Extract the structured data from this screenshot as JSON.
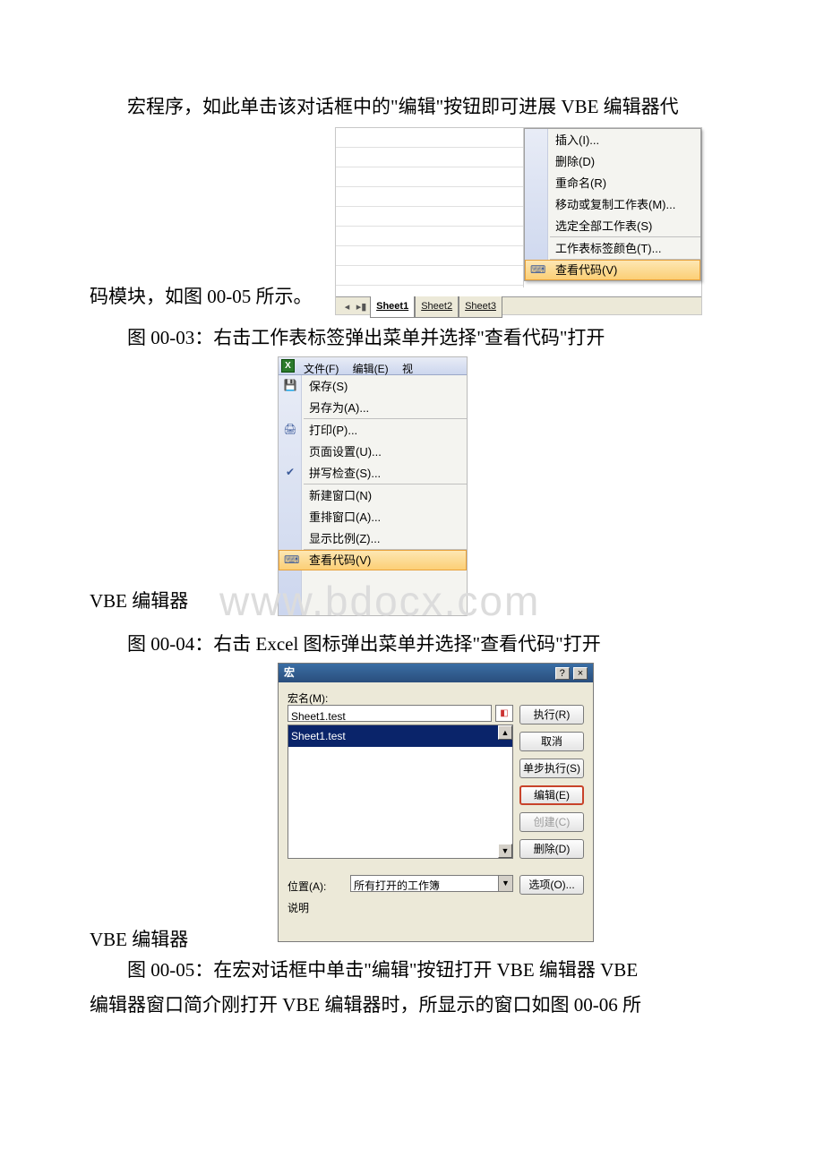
{
  "para1_a": "宏程序，如此单击该对话框中的\"编辑\"按钮即可进展 ",
  "para1_b": "VBE",
  "para1_c": " 编辑器代",
  "para2_a": "码模块，如图 00-05 所示。",
  "cap3": "图 00-03：右击工作表标签弹出菜单并选择\"查看代码\"打开",
  "cap4_a": "VBE",
  "cap4_b": " 编辑器",
  "cap4_full": "图 00-04：右击 Excel 图标弹出菜单并选择\"查看代码\"打开",
  "cap5_a": "VBE",
  "cap5_b": " 编辑器",
  "cap5_full_a": "图 00-05：在宏对话框中单击\"编辑\"按钮打开 ",
  "cap5_full_b": "VBE",
  "cap5_full_c": " 编辑器 ",
  "cap5_full_d": "VBE",
  "cap5_full_e": "编辑器窗口简介刚打开 ",
  "cap5_full_f": "VBE",
  "cap5_full_g": " 编辑器时，所显示的窗口如图 00-06 所",
  "watermark": "www.bdocx.com",
  "fig3": {
    "menu": {
      "insert": "插入(I)...",
      "delete": "删除(D)",
      "rename": "重命名(R)",
      "movecopy": "移动或复制工作表(M)...",
      "selectall": "选定全部工作表(S)",
      "tabcolor": "工作表标签颜色(T)...",
      "viewcode": "查看代码(V)"
    },
    "tabs": {
      "nav": "▸ ▸|",
      "s1": "Sheet1",
      "s2": "Sheet2",
      "s3": "Sheet3"
    }
  },
  "fig4": {
    "xicon": "X",
    "menubar": {
      "file": "文件(F)",
      "edit": "编辑(E)",
      "view": "视"
    },
    "menu": {
      "save": "保存(S)",
      "saveas": "另存为(A)...",
      "print": "打印(P)...",
      "pagesetup": "页面设置(U)...",
      "spell": "拼写检查(S)...",
      "newwin": "新建窗口(N)",
      "arrange": "重排窗口(A)...",
      "zoom": "显示比例(Z)...",
      "viewcode": "查看代码(V)"
    }
  },
  "fig5": {
    "title": "宏",
    "help": "?",
    "close": "×",
    "macroname_label": "宏名(M):",
    "macroname_value": "Sheet1.test",
    "list_item": "Sheet1.test",
    "location_label": "位置(A):",
    "location_value": "所有打开的工作簿",
    "desc_label": "说明",
    "buttons": {
      "run": "执行(R)",
      "cancel": "取消",
      "step": "单步执行(S)",
      "edit": "编辑(E)",
      "create": "创建(C)",
      "delete": "删除(D)",
      "options": "选项(O)..."
    }
  }
}
